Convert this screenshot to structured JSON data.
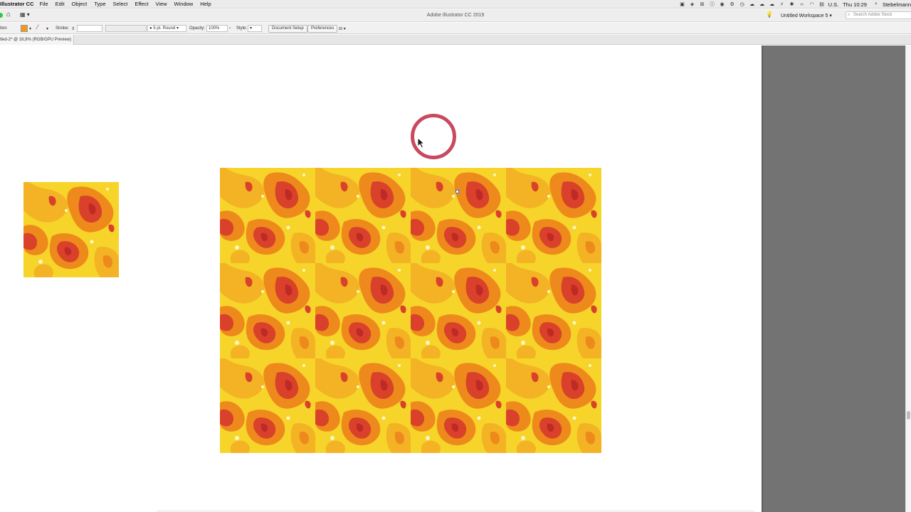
{
  "menubar": {
    "app_name": "Illustrator CC",
    "menus": [
      "File",
      "Edit",
      "Object",
      "Type",
      "Select",
      "Effect",
      "View",
      "Window",
      "Help"
    ],
    "input_source": "U.S.",
    "clock": "Thu 10:29",
    "user": "Stebelmann"
  },
  "appbar": {
    "title": "Adobe Illustrator CC 2019",
    "workspace": "Untitled Workspace 5",
    "search_placeholder": "Search Adobe Stock"
  },
  "controlbar": {
    "selection_label": "tion",
    "stroke_label": "Stroke:",
    "brush_value": "5 pt. Round",
    "opacity_label": "Opacity:",
    "opacity_value": "100%",
    "style_label": "Style:",
    "document_setup": "Document Setup",
    "preferences": "Preferences"
  },
  "document": {
    "tab_label": "tled-2* @ 16,9% (RGB/GPU Preview)"
  },
  "colors": {
    "pattern_yellow": "#f6d42a",
    "pattern_gold": "#f3b324",
    "pattern_orange": "#ee8a1c",
    "pattern_red": "#d9412b",
    "pattern_dark_red": "#bf2a26",
    "pasteboard": "#737373",
    "click_ring": "#c84a5e"
  }
}
